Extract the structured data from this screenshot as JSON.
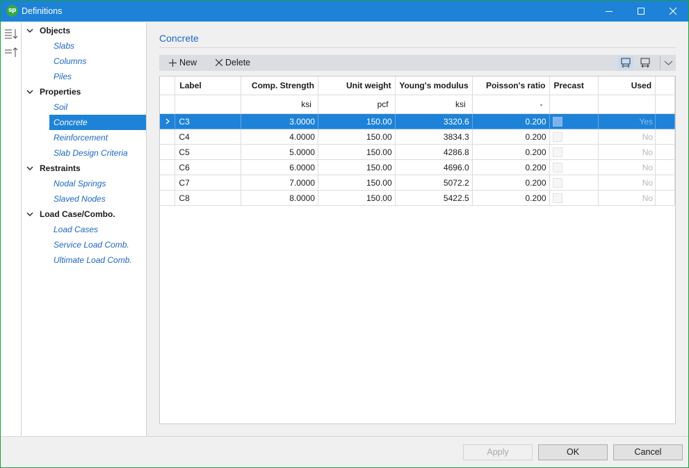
{
  "window": {
    "title": "Definitions",
    "logo_text": "sp"
  },
  "tree": [
    {
      "label": "Objects",
      "items": [
        "Slabs",
        "Columns",
        "Piles"
      ]
    },
    {
      "label": "Properties",
      "items": [
        "Soil",
        "Concrete",
        "Reinforcement",
        "Slab Design Criteria"
      ]
    },
    {
      "label": "Restraints",
      "items": [
        "Nodal Springs",
        "Slaved Nodes"
      ]
    },
    {
      "label": "Load Case/Combo.",
      "items": [
        "Load Cases",
        "Service Load Comb.",
        "Ultimate Load Comb."
      ]
    }
  ],
  "selected_item": "Concrete",
  "section": {
    "title": "Concrete"
  },
  "toolbar": {
    "new_label": "New",
    "delete_label": "Delete"
  },
  "table": {
    "headers": [
      "Label",
      "Comp. Strength",
      "Unit weight",
      "Young's modulus",
      "Poisson's ratio",
      "Precast",
      "Used"
    ],
    "units": [
      "",
      "ksi",
      "pcf",
      "ksi",
      "-",
      "",
      ""
    ],
    "rows": [
      {
        "label": "C3",
        "strength": "3.0000",
        "weight": "150.00",
        "modulus": "3320.6",
        "poisson": "0.200",
        "precast": false,
        "used": "Yes"
      },
      {
        "label": "C4",
        "strength": "4.0000",
        "weight": "150.00",
        "modulus": "3834.3",
        "poisson": "0.200",
        "precast": false,
        "used": "No"
      },
      {
        "label": "C5",
        "strength": "5.0000",
        "weight": "150.00",
        "modulus": "4286.8",
        "poisson": "0.200",
        "precast": false,
        "used": "No"
      },
      {
        "label": "C6",
        "strength": "6.0000",
        "weight": "150.00",
        "modulus": "4696.0",
        "poisson": "0.200",
        "precast": false,
        "used": "No"
      },
      {
        "label": "C7",
        "strength": "7.0000",
        "weight": "150.00",
        "modulus": "5072.2",
        "poisson": "0.200",
        "precast": false,
        "used": "No"
      },
      {
        "label": "C8",
        "strength": "8.0000",
        "weight": "150.00",
        "modulus": "5422.5",
        "poisson": "0.200",
        "precast": false,
        "used": "No"
      }
    ],
    "selected_row": "C3"
  },
  "footer": {
    "apply_label": "Apply",
    "ok_label": "OK",
    "cancel_label": "Cancel"
  },
  "colors": {
    "accent": "#1e82d8",
    "link": "#1e66c4",
    "window_border": "#18a13a",
    "logo": "#35a84c"
  }
}
